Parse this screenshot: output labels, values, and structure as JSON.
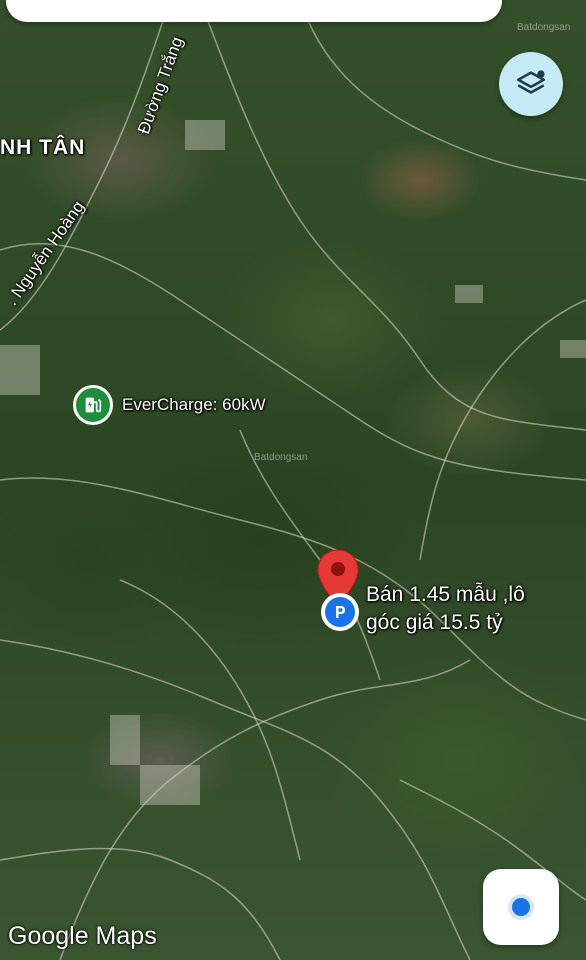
{
  "map": {
    "view": "satellite",
    "place_label": "NH TÂN",
    "roads": [
      "Đường Trắng",
      ". Nguyễn Hoàng"
    ]
  },
  "ev_station": {
    "label": "EverCharge: 60kW",
    "icon": "ev-charger-icon",
    "color": "#1e8e3e"
  },
  "listing": {
    "line1": "Bán 1.45 mẫu ,lô",
    "line2": "góc  giá 15.5 tỷ",
    "pin_icon": "location-pin-icon",
    "pin_color": "#e53935",
    "marker_icon": "parking-marker-icon",
    "marker_letter": "P",
    "marker_color": "#1a73e8"
  },
  "watermarks": [
    "Batdongsan",
    "Batdongsan"
  ],
  "controls": {
    "layers_icon": "layers-icon",
    "layers_bg": "#c3eaf5",
    "locate_icon": "my-location-icon"
  },
  "branding": {
    "logo": "Google Maps"
  }
}
